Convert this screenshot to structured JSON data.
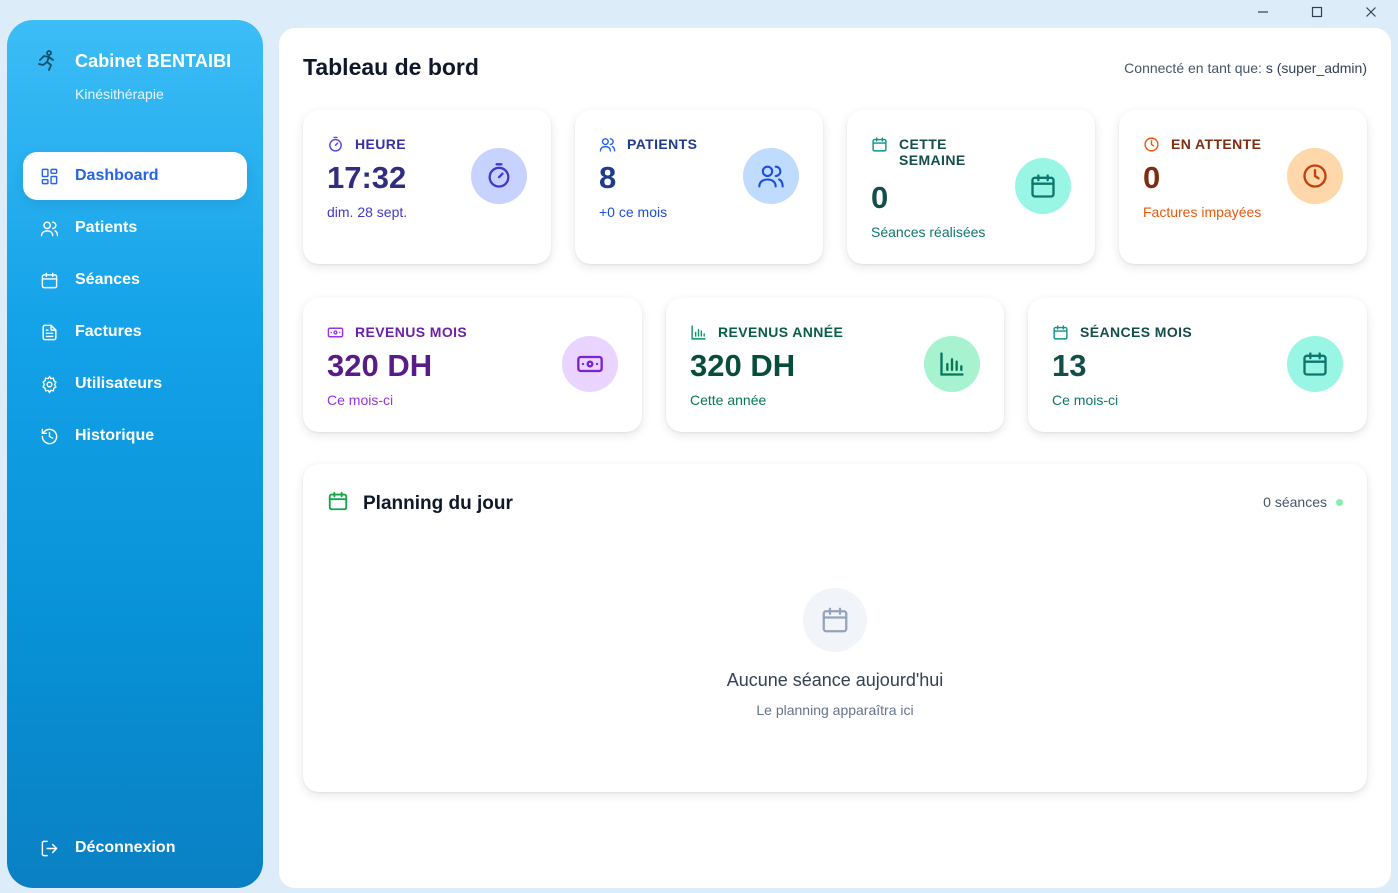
{
  "window": {
    "minimize": "minimize-icon",
    "maximize": "maximize-icon",
    "close": "close-icon"
  },
  "sidebar": {
    "brand_title": "Cabinet BENTAIBI",
    "brand_subtitle": "Kinésithérapie",
    "items": [
      {
        "label": "Dashboard",
        "icon": "dashboard-icon",
        "active": true
      },
      {
        "label": "Patients",
        "icon": "users-icon"
      },
      {
        "label": "Séances",
        "icon": "calendar-icon"
      },
      {
        "label": "Factures",
        "icon": "file-icon"
      },
      {
        "label": "Utilisateurs",
        "icon": "gear-icon"
      },
      {
        "label": "Historique",
        "icon": "history-icon"
      }
    ],
    "logout": "Déconnexion"
  },
  "header": {
    "title": "Tableau de bord",
    "connected_prefix": "Connecté en tant que:",
    "connected_user": "s (super_admin)"
  },
  "cards": {
    "heure": {
      "label": "HEURE",
      "value": "17:32",
      "sub": "dim. 28 sept.",
      "accent": "#3730a3"
    },
    "patients": {
      "label": "PATIENTS",
      "value": "8",
      "sub": "+0 ce mois",
      "accent": "#1e3a8a"
    },
    "semaine": {
      "label": "CETTE SEMAINE",
      "label_line1": "CETTE",
      "label_line2": "SEMAINE",
      "value": "0",
      "sub": "Séances réalisées",
      "accent": "#134e4a"
    },
    "attente": {
      "label": "EN ATTENTE",
      "value": "0",
      "sub": "Factures impayées",
      "accent": "#7c2d12"
    },
    "revenus_mois": {
      "label": "REVENUS MOIS",
      "value": "320 DH",
      "sub": "Ce mois-ci",
      "accent": "#581c87"
    },
    "revenus_annee": {
      "label": "REVENUS ANNÉE",
      "value": "320 DH",
      "sub": "Cette année",
      "accent": "#064e3b"
    },
    "seances_mois": {
      "label": "SÉANCES MOIS",
      "value": "13",
      "sub": "Ce mois-ci",
      "accent": "#134e4a"
    }
  },
  "planning": {
    "title": "Planning du jour",
    "count": "0 séances",
    "empty_title": "Aucune séance aujourd'hui",
    "empty_sub": "Le planning apparaîtra ici"
  }
}
